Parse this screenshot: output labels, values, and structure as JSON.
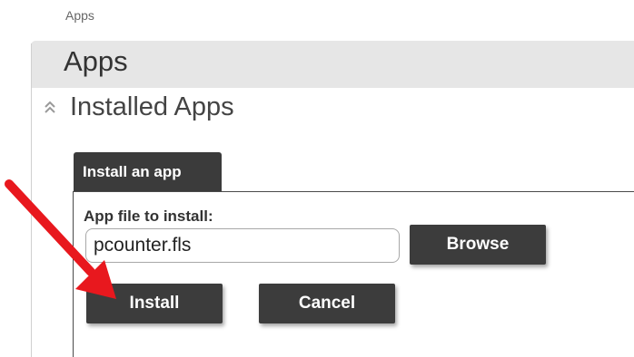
{
  "breadcrumb": {
    "label": "Apps"
  },
  "header": {
    "title": "Apps"
  },
  "section": {
    "title": "Installed Apps",
    "toggle_icon": "double-chevron-up-icon"
  },
  "install_panel": {
    "tab_label": "Install an app",
    "field_label": "App file to install:",
    "file_value": "pcounter.fls",
    "browse_label": "Browse",
    "install_label": "Install",
    "cancel_label": "Cancel"
  },
  "annotation": {
    "icon": "red-arrow-icon",
    "color": "#e8181e"
  },
  "colors": {
    "button_bg": "#3c3c3c",
    "header_bg": "#e6e6e6"
  }
}
